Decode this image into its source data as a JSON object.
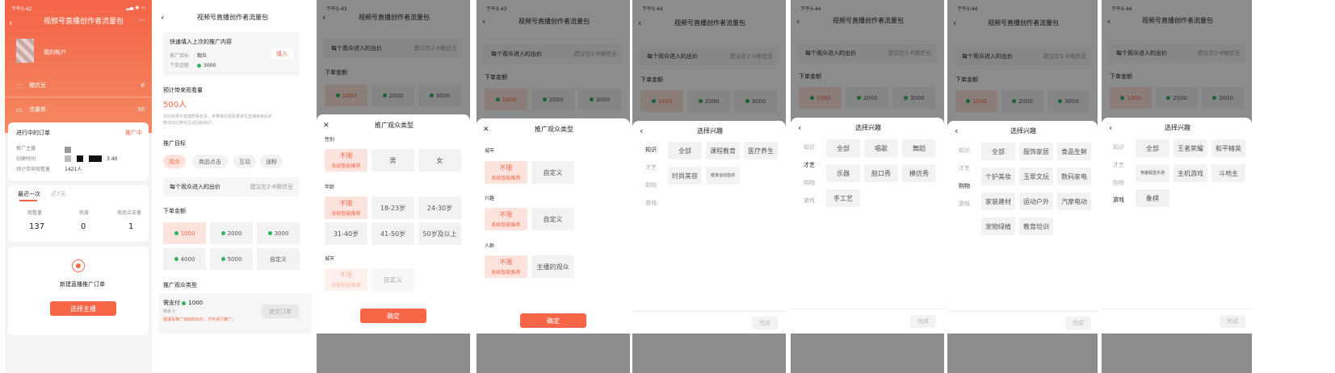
{
  "status_time": "下午5:42",
  "status_time2": "下午5:43",
  "status_time3": "下午5:44",
  "screen1": {
    "title": "视频号直播创作者流量包",
    "account_label": "我的账户",
    "wx_bean_label": "微信豆",
    "wx_bean_value": "6",
    "flow_ticket_label": "流量券",
    "flow_ticket_value": "30",
    "ongoing_orders": "进行中的订单",
    "promoting": "推广中",
    "fields": [
      "推广主播",
      "创建时间",
      "预计带来观看量"
    ],
    "time_value": "3:40",
    "view_value": "1421人",
    "tabs": [
      "最近一次",
      "近7天"
    ],
    "stats": [
      {
        "label": "观看量",
        "value": "137"
      },
      {
        "label": "热度",
        "value": "0"
      },
      {
        "label": "商品点击量",
        "value": "1"
      }
    ],
    "new_order": "新建直播推广订单",
    "choose_host": "选择主播"
  },
  "screen2": {
    "title": "视频号直播创作者流量包",
    "quick_fill": "快速填入上次的推广内容",
    "fill_btn": "填入",
    "target_label": "推广目标",
    "target_value": "观众",
    "amount_label": "下单金额",
    "amount_value": "3000",
    "expected": "预计带来观看量",
    "expected_value": "500人",
    "expected_note1": "实际效果与直播质量有关，未带来的观看量将在直播结束后折",
    "expected_note2": "算成对应微信豆返回给用户。",
    "goal_title": "推广目标",
    "goals": [
      "观众",
      "商品点击",
      "互动",
      "涨粉"
    ],
    "bid_label": "每个观众进入的出价",
    "bid_hint": "建议在2-6微信豆",
    "amount_title": "下单金额",
    "amounts": [
      "1000",
      "2000",
      "3000",
      "4000",
      "5000",
      "自定义"
    ],
    "audience_title": "推广观众类型",
    "pay_label": "需支付",
    "pay_value": "1000",
    "remain": "剩余 6",
    "warn": "需填写推广目标的出价，才可进行推广。",
    "submit": "提交订单"
  },
  "common": {
    "bid_label": "每个观众进入的出价",
    "bid_hint": "建议在2-6微信豆",
    "amount_title": "下单金额",
    "amounts": [
      "1000",
      "2000",
      "3000"
    ]
  },
  "screen3": {
    "sheet_title": "推广观众类型",
    "gender": "性别",
    "gender_opts": [
      "不限",
      "男",
      "女"
    ],
    "unlimited_sub": "系统智能推荐",
    "age": "年龄",
    "age_opts": [
      "不限",
      "18-23岁",
      "24-30岁",
      "31-40岁",
      "41-50岁",
      "50岁及以上"
    ],
    "city": "城市",
    "city_opts": [
      "不限",
      "自定义"
    ],
    "confirm": "确定"
  },
  "screen4": {
    "sheet_title": "推广观众类型",
    "city": "城市",
    "interest": "兴趣",
    "crowd": "人群",
    "custom": "自定义",
    "unlimited": "不限",
    "unlimited_sub": "系统智能推荐",
    "host_audience": "主播的观众",
    "confirm": "确定"
  },
  "interest": {
    "sheet_title": "选择兴趣",
    "categories": [
      "知识",
      "才艺",
      "购物",
      "游戏"
    ],
    "done": "完成",
    "knowledge": [
      "全部",
      "课程教育",
      "医疗养生",
      "时尚美容",
      "健身运动指体"
    ],
    "talent": [
      "全部",
      "唱歌",
      "舞蹈",
      "乐器",
      "脱口秀",
      "模仿秀",
      "手工艺"
    ],
    "shopping": [
      "全部",
      "服饰家居",
      "食品生鲜",
      "个护美妆",
      "玉翠文玩",
      "数码家电",
      "家装建材",
      "运动户外",
      "汽摩电动",
      "宠物绿植",
      "教育培训"
    ],
    "gaming": [
      "全部",
      "王者荣耀",
      "和平精英",
      "英雄联盟手游",
      "主机游戏",
      "斗地主",
      "象棋"
    ]
  },
  "colors": {
    "accent": "#f56546",
    "orange_header": "#f6714f"
  }
}
